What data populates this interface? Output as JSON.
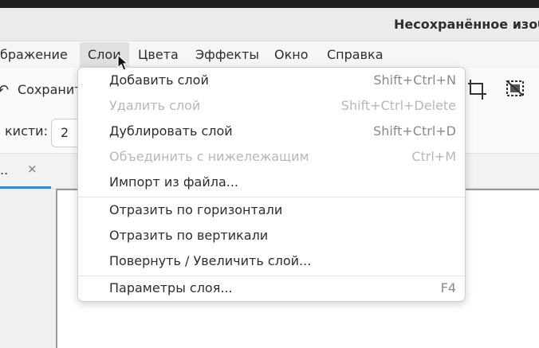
{
  "window": {
    "title": "Несохранённое изоб"
  },
  "menubar": {
    "items": [
      {
        "label": "бражение"
      },
      {
        "label": "Слои"
      },
      {
        "label": "Цвета"
      },
      {
        "label": "Эффекты"
      },
      {
        "label": "Окно"
      },
      {
        "label": "Справка"
      }
    ],
    "active": "Слои"
  },
  "toolbar": {
    "save_label": "Сохранит"
  },
  "options": {
    "brush_label": "кисти:",
    "brush_value": "2"
  },
  "tabs": [
    {
      "label": "..",
      "close_icon": "×"
    }
  ],
  "layers_menu": {
    "items": [
      {
        "label": "Добавить слой",
        "shortcut": "Shift+Ctrl+N",
        "enabled": true
      },
      {
        "label": "Удалить слой",
        "shortcut": "Shift+Ctrl+Delete",
        "enabled": false
      },
      {
        "label": "Дублировать слой",
        "shortcut": "Shift+Ctrl+D",
        "enabled": true
      },
      {
        "label": "Объединить с нижележащим",
        "shortcut": "Ctrl+M",
        "enabled": false
      },
      {
        "label": "Импорт из файла...",
        "shortcut": "",
        "enabled": true
      },
      {
        "label": "Отразить по горизонтали",
        "shortcut": "",
        "enabled": true
      },
      {
        "label": "Отразить по вертикали",
        "shortcut": "",
        "enabled": true
      },
      {
        "label": "Повернуть / Увеличить слой...",
        "shortcut": "",
        "enabled": true
      },
      {
        "label": "Параметры слоя...",
        "shortcut": "F4",
        "enabled": true
      }
    ]
  },
  "icons": {
    "undo": "undo-icon",
    "crop": "crop-icon",
    "deselect": "deselect-icon",
    "cursor": "mouse-pointer-icon"
  },
  "colors": {
    "accent": "#3584e4"
  }
}
